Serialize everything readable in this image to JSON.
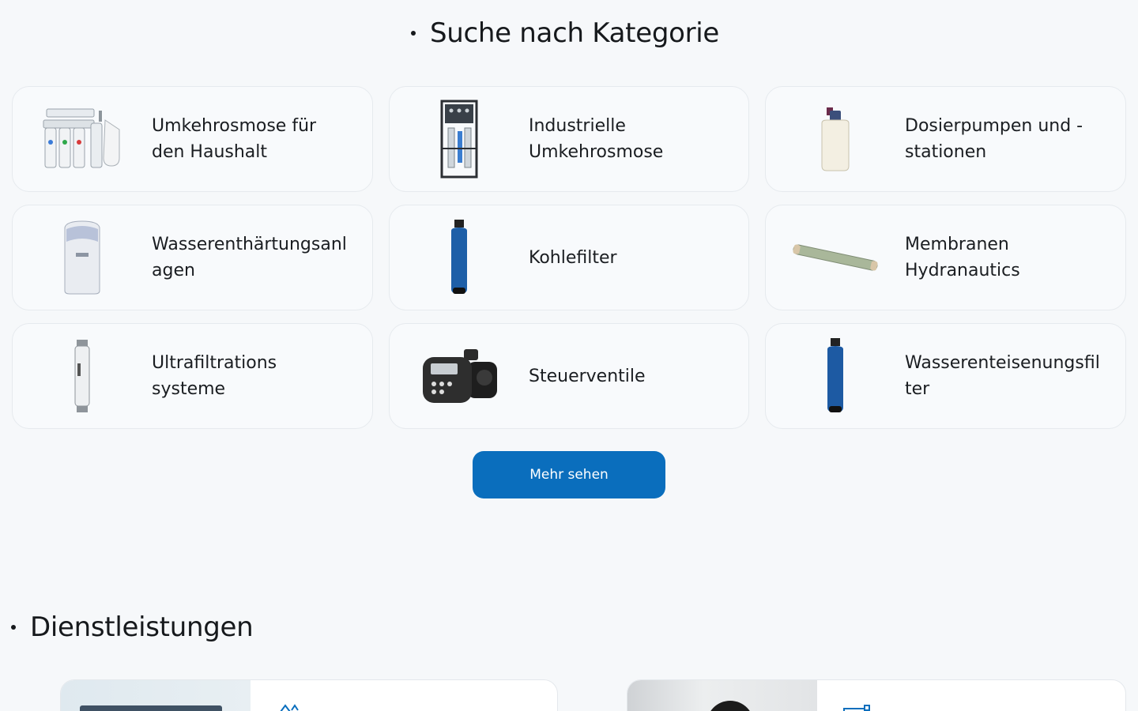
{
  "categories_section": {
    "title": "Suche nach Kategorie"
  },
  "categories": [
    {
      "label": "Umkehrosmose für\nden Haushalt",
      "icon": "household-ro-system-icon"
    },
    {
      "label": "Industrielle\nUmkehrosmose",
      "icon": "industrial-ro-icon"
    },
    {
      "label": "Dosierpumpen und -\nstationen",
      "icon": "dosing-tank-icon"
    },
    {
      "label": "Wasserenthärtungsanl\nagen",
      "icon": "water-softener-icon"
    },
    {
      "label": "Kohlefilter",
      "icon": "carbon-filter-icon"
    },
    {
      "label": "Membranen\nHydranautics",
      "icon": "membrane-icon"
    },
    {
      "label": "Ultrafiltrations\nsysteme",
      "icon": "ultrafiltration-icon"
    },
    {
      "label": "Steuerventile",
      "icon": "control-valve-icon"
    },
    {
      "label": "Wasserenteisenungsfil\nter",
      "icon": "iron-removal-filter-icon"
    }
  ],
  "more_button": {
    "label": "Mehr sehen"
  },
  "services_section": {
    "title": "Dienstleistungen"
  },
  "colors": {
    "accent": "#0a6ebd",
    "background": "#f6f8fa",
    "card_border": "#e6eaee"
  }
}
